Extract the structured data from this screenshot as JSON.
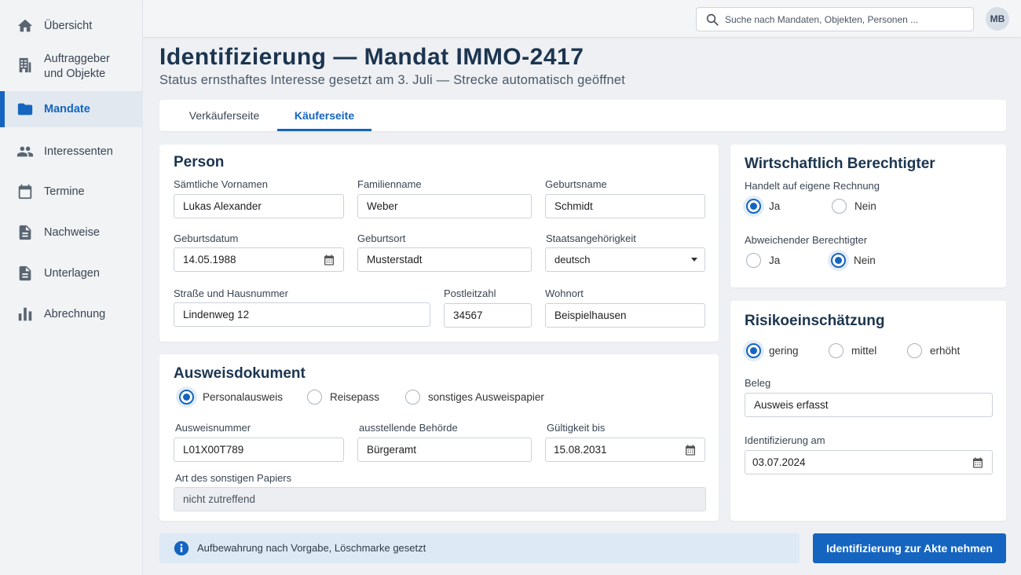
{
  "sidebar": {
    "items": [
      {
        "label": "Übersicht",
        "icon": "home-icon"
      },
      {
        "label": "Auftraggeber und Objekte",
        "icon": "building-icon"
      },
      {
        "label": "Mandate",
        "icon": "folder-icon",
        "active": true
      },
      {
        "label": "Interessenten",
        "icon": "people-icon"
      },
      {
        "label": "Termine",
        "icon": "calendar-icon"
      },
      {
        "label": "Nachweise",
        "icon": "document-icon"
      },
      {
        "label": "Unterlagen",
        "icon": "document-icon"
      },
      {
        "label": "Abrechnung",
        "icon": "bar-chart-icon"
      }
    ]
  },
  "topbar": {
    "search_placeholder": "Suche nach Mandaten, Objekten, Personen ...",
    "avatar_initials": "MB"
  },
  "header": {
    "title": "Identifizierung — Mandat IMMO-2417",
    "subtitle": "Status ernsthaftes Interesse gesetzt am 3. Juli — Strecke automatisch geöffnet"
  },
  "tabs": [
    {
      "label": "Verkäuferseite",
      "active": false
    },
    {
      "label": "Käuferseite",
      "active": true
    }
  ],
  "person": {
    "title": "Person",
    "vornamen": {
      "label": "Sämtliche Vornamen",
      "value": "Lukas Alexander"
    },
    "familienname": {
      "label": "Familienname",
      "value": "Weber"
    },
    "geburtsname": {
      "label": "Geburtsname",
      "value": "Schmidt"
    },
    "geburtsdatum": {
      "label": "Geburtsdatum",
      "value": "14.05.1988"
    },
    "geburtsort": {
      "label": "Geburtsort",
      "value": "Musterstadt"
    },
    "staatsangehoerigkeit": {
      "label": "Staatsangehörigkeit",
      "value": "deutsch"
    },
    "strasse": {
      "label": "Straße und Hausnummer",
      "value": "Lindenweg 12"
    },
    "plz": {
      "label": "Postleitzahl",
      "value": "34567"
    },
    "wohnort": {
      "label": "Wohnort",
      "value": "Beispielhausen"
    }
  },
  "ausweis": {
    "title": "Ausweisdokument",
    "options": [
      "Personalausweis",
      "Reisepass",
      "sonstiges Ausweispapier"
    ],
    "selected": "Personalausweis",
    "nummer": {
      "label": "Ausweisnummer",
      "value": "L01X00T789"
    },
    "behoerde": {
      "label": "ausstellende Behörde",
      "value": "Bürgeramt"
    },
    "gueltigkeit": {
      "label": "Gültigkeit bis",
      "value": "15.08.2031"
    },
    "art": {
      "label": "Art des sonstigen Papiers",
      "value": "nicht zutreffend"
    }
  },
  "wirtschaftlich": {
    "title": "Wirtschaftlich Berechtigter",
    "q1": {
      "label": "Handelt auf eigene Rechnung",
      "options": [
        "Ja",
        "Nein"
      ],
      "selected": "Ja"
    },
    "q2": {
      "label": "Abweichender Berechtigter",
      "options": [
        "Ja",
        "Nein"
      ],
      "selected": "Nein"
    }
  },
  "risiko": {
    "title": "Risikoeinschätzung",
    "options": [
      "gering",
      "mittel",
      "erhöht"
    ],
    "selected": "gering",
    "beleg": {
      "label": "Beleg",
      "value": "Ausweis erfasst"
    },
    "identifizierung_am": {
      "label": "Identifizierung am",
      "value": "03.07.2024"
    }
  },
  "footer": {
    "info_text": "Aufbewahrung nach Vorgabe, Löschmarke gesetzt",
    "primary_button": "Identifizierung zur Akte nehmen"
  },
  "colors": {
    "accent": "#1565c0",
    "background": "#eef0f3",
    "info_bg": "#dde9f5"
  }
}
